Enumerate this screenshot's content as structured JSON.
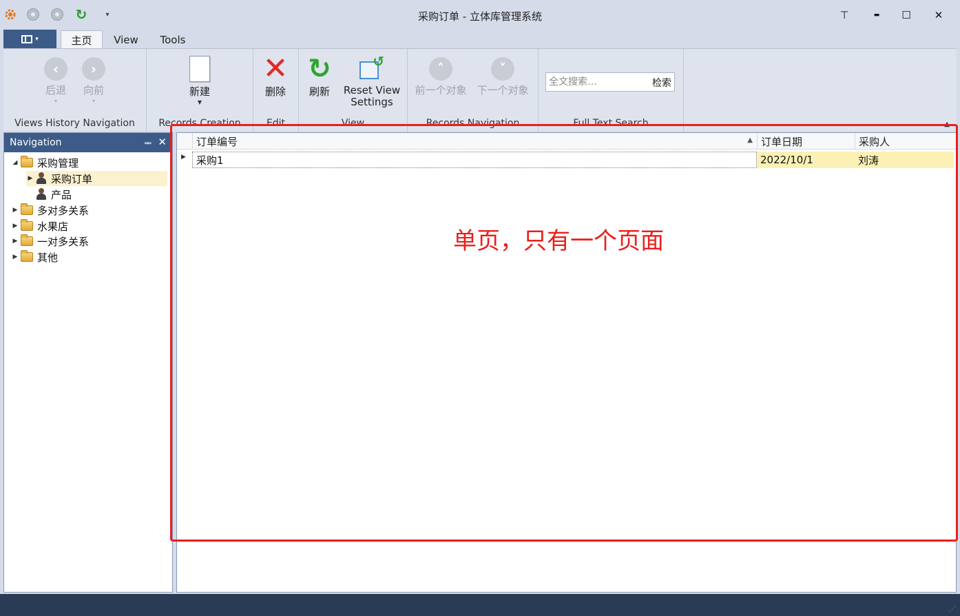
{
  "window": {
    "title": "采购订单 - 立体库管理系统",
    "restore_glyph": "⊤",
    "minimize_glyph": "▬",
    "maximize_glyph": "☐",
    "close_glyph": "✕"
  },
  "qat": {
    "refresh_glyph": "↻",
    "dropdown_glyph": "▾"
  },
  "ribbon": {
    "tabs": [
      {
        "label": "主页",
        "active": true
      },
      {
        "label": "View",
        "active": false
      },
      {
        "label": "Tools",
        "active": false
      }
    ],
    "groups": {
      "history": {
        "label": "Views History Navigation",
        "back_label": "后退",
        "forward_label": "向前"
      },
      "creation": {
        "label": "Records Creation",
        "new_label": "新建"
      },
      "edit": {
        "label": "Edit",
        "delete_label": "删除"
      },
      "view": {
        "label": "View",
        "refresh_label": "刷新",
        "reset_label_line1": "Reset View",
        "reset_label_line2": "Settings"
      },
      "records_nav": {
        "label": "Records Navigation",
        "prev_label": "前一个对象",
        "next_label": "下一个对象"
      },
      "search": {
        "label": "Full Text Search",
        "placeholder": "全文搜索…",
        "button_label": "检索"
      }
    }
  },
  "navigation": {
    "title": "Navigation",
    "pin_glyph": "ᆍ",
    "close_glyph": "✕",
    "items": [
      {
        "label": "采购管理",
        "expander": "◢"
      },
      {
        "label": "采购订单",
        "expander": "▶"
      },
      {
        "label": "产品",
        "expander": ""
      },
      {
        "label": "多对多关系",
        "expander": "▶"
      },
      {
        "label": "水果店",
        "expander": "▶"
      },
      {
        "label": "一对多关系",
        "expander": "▶"
      },
      {
        "label": "其他",
        "expander": "▶"
      }
    ]
  },
  "grid": {
    "columns": [
      "订单编号",
      "订单日期",
      "采购人"
    ],
    "sort_glyph": "▲",
    "row_indicator": "▶",
    "rows": [
      [
        "采购1",
        "2022/10/1",
        "刘涛"
      ]
    ]
  },
  "annotation": {
    "text": "单页，只有一个页面",
    "color": "#e8201c"
  },
  "colors": {
    "accent": "#3c5b88",
    "statusbar": "#2a3b55",
    "selection": "#fbf1cf",
    "delete_red": "#e02929",
    "refresh_green": "#2ea52e"
  }
}
